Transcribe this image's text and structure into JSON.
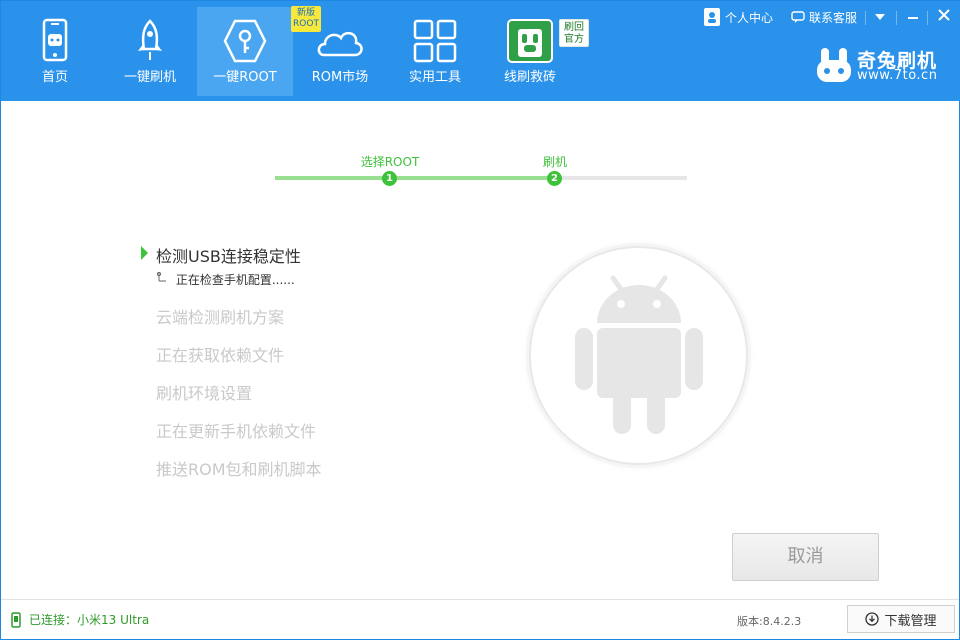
{
  "nav": {
    "items": [
      {
        "label": "首页",
        "icon": "phone-rabbit-icon"
      },
      {
        "label": "一键刷机",
        "icon": "rocket-icon"
      },
      {
        "label": "一键ROOT",
        "icon": "root-key-icon"
      },
      {
        "label": "ROM市场",
        "icon": "cloud-icon"
      },
      {
        "label": "实用工具",
        "icon": "grid-tools-icon"
      },
      {
        "label": "线刷救砖",
        "icon": "rescue-rabbit-icon"
      }
    ],
    "active_index": 2,
    "badge_new": {
      "line1": "新版",
      "line2": "ROOT"
    },
    "badge_official": {
      "line1": "刷回",
      "line2": "官方"
    }
  },
  "window": {
    "user_center": "个人中心",
    "support": "联系客服",
    "menu_icon": "dropdown-icon",
    "minimize_icon": "minimize-icon",
    "close_icon": "close-icon"
  },
  "brand": {
    "name": "奇兔刷机",
    "url": "www.7to.cn"
  },
  "steps": {
    "items": [
      {
        "label": "选择ROOT",
        "number": "1"
      },
      {
        "label": "刷机",
        "number": "2"
      }
    ],
    "progress_fraction": 0.68
  },
  "tasks": {
    "current": "检测USB连接稳定性",
    "current_detail": "正在检查手机配置......",
    "pending": [
      "云端检测刷机方案",
      "正在获取依赖文件",
      "刷机环境设置",
      "正在更新手机依赖文件",
      "推送ROM包和刷机脚本"
    ]
  },
  "actions": {
    "cancel_label": "取消"
  },
  "status": {
    "connected": "已连接：小米13 Ultra",
    "version": "版本:8.4.2.3",
    "download_manager": "下载管理"
  },
  "colors": {
    "header": "#2a92ea",
    "accent_green": "#3ec23a"
  }
}
